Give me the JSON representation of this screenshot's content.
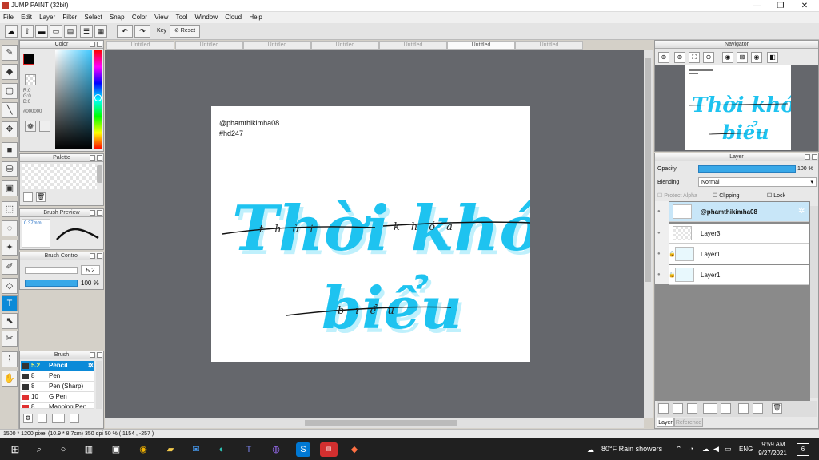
{
  "app": {
    "title": "JUMP PAINT (32bit)"
  },
  "window_controls": {
    "minimize": "—",
    "maximize": "❐",
    "close": "✕"
  },
  "menu": [
    "File",
    "Edit",
    "Layer",
    "Filter",
    "Select",
    "Snap",
    "Color",
    "View",
    "Tool",
    "Window",
    "Cloud",
    "Help"
  ],
  "toolbar": {
    "key_label": "Key",
    "reset_label": "Reset"
  },
  "color_panel": {
    "title": "Color",
    "r": "R:0",
    "g": "G:0",
    "b": "B:0",
    "hex": "#000000"
  },
  "palette_panel": {
    "title": "Palette",
    "dash": "---"
  },
  "brush_preview": {
    "title": "Brush Preview",
    "size": "0.37mm"
  },
  "brush_control": {
    "title": "Brush Control",
    "size_value": "5.2",
    "opacity_value": "100 %"
  },
  "brush_panel": {
    "title": "Brush",
    "items": [
      {
        "size": "5.2",
        "name": "Pencil",
        "color": "#333333"
      },
      {
        "size": "8",
        "name": "Pen",
        "color": "#333333"
      },
      {
        "size": "8",
        "name": "Pen (Sharp)",
        "color": "#333333"
      },
      {
        "size": "10",
        "name": "G Pen",
        "color": "#e03030"
      },
      {
        "size": "8",
        "name": "Mapping Pen",
        "color": "#e03030"
      }
    ]
  },
  "tabs": [
    "Untitled",
    "Untitled",
    "Untitled",
    "Untitled",
    "Untitled",
    "Untitled",
    "Untitled"
  ],
  "canvas": {
    "handle": "@phamthikimha08",
    "tag": "#hd247",
    "line1": "Thời khóa",
    "line2": "biểu",
    "ghost1": "thời",
    "ghost2": "khóa",
    "ghost3": "biểu"
  },
  "navigator": {
    "title": "Navigator"
  },
  "layer_panel": {
    "title": "Layer",
    "opacity_label": "Opacity",
    "opacity_value": "100 %",
    "blending_label": "Blending",
    "blending_value": "Normal",
    "protect_alpha": "Protect Alpha",
    "clipping": "Clipping",
    "lock": "Lock",
    "layers": [
      {
        "name": "@phamthikimha08"
      },
      {
        "name": "Layer3"
      },
      {
        "name": "Layer1"
      },
      {
        "name": "Layer1"
      }
    ],
    "bottom_tabs": [
      "Layer",
      "Reference"
    ]
  },
  "status": {
    "text": "1500 * 1200 pixel   (10.9 * 8.7cm)   350 dpi   50 %   ( 1154 , -257 )"
  },
  "taskbar": {
    "weather": "80°F  Rain showers",
    "lang": "ENG",
    "time": "9:59 AM",
    "date": "9/27/2021",
    "notif": "6"
  },
  "colors": {
    "accent": "#0b8ad8",
    "lettering": "#1ec3f0"
  }
}
